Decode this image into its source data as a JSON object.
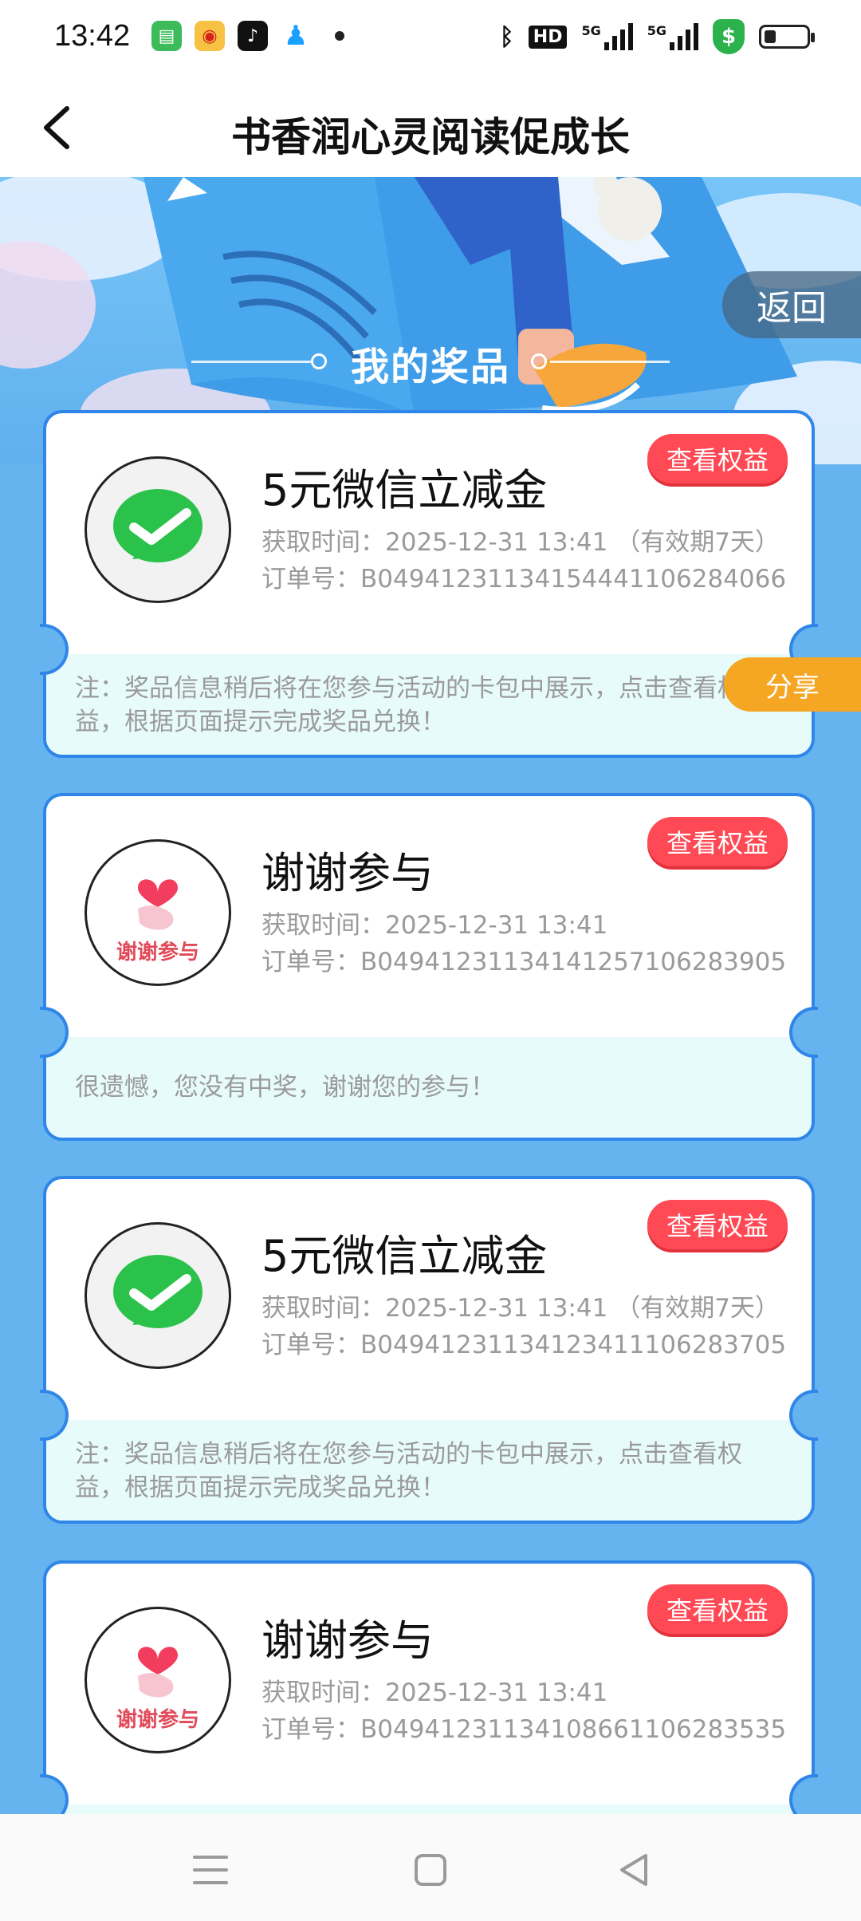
{
  "status_bar": {
    "time": "13:42",
    "hd_label": "HD",
    "signal1_label": "5G",
    "signal2_label": "5G",
    "icons": [
      "messages-icon",
      "weibo-icon",
      "tiktok-icon",
      "qq-icon",
      "bluetooth-icon",
      "shield-icon",
      "battery-icon"
    ]
  },
  "header": {
    "title": "书香润心灵阅读促成长"
  },
  "banner": {
    "section_title": "我的奖品",
    "return_label": "返回",
    "share_label": "分享"
  },
  "cards": [
    {
      "title": "5元微信立减金",
      "time_line": "获取时间：2025-12-31 13:41 （有效期7天）",
      "order_line": "订单号：B0494123113415444110628406​6",
      "button": "查看权益",
      "note": "注：奖品信息稍后将在您参与活动的卡包中展示，点击查看权益，根据页面提示完成奖品兑换！",
      "icon": "wechat-icon"
    },
    {
      "title": "谢谢参与",
      "time_line": "获取时间：2025-12-31 13:41",
      "order_line": "订单号：B04941231134141257106283905",
      "button": "查看权益",
      "note": "很遗憾，您没有中奖，谢谢您的参与！",
      "icon": "thanks-icon",
      "icon_text": "谢谢参与"
    },
    {
      "title": "5元微信立减金",
      "time_line": "获取时间：2025-12-31 13:41 （有效期7天）",
      "order_line": "订单号：B04941231134123411106283705",
      "button": "查看权益",
      "note": "注：奖品信息稍后将在您参与活动的卡包中展示，点击查看权益，根据页面提示完成奖品兑换！",
      "icon": "wechat-icon"
    },
    {
      "title": "谢谢参与",
      "time_line": "获取时间：2025-12-31 13:41",
      "order_line": "订单号：B04941231134108661106283535",
      "button": "查看权益",
      "note": "",
      "icon": "thanks-icon",
      "icon_text": "谢谢参与"
    }
  ],
  "colors": {
    "accent_blue": "#2f86e8",
    "page_blue": "#66b4ef",
    "button_red": "#ff4a55",
    "share_orange": "#f5a623",
    "note_bg": "#e8fbfb"
  }
}
